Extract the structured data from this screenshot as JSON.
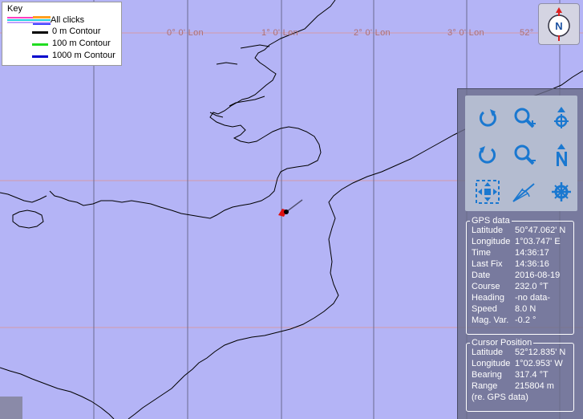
{
  "map": {
    "longitude_labels": [
      "0° 0' Lon",
      "1° 0' Lon",
      "2° 0' Lon",
      "3° 0' Lon",
      "52°"
    ]
  },
  "key": {
    "title": "Key",
    "clicks_label": "All clicks",
    "items": [
      {
        "label": "0 m Contour",
        "color": "#000000"
      },
      {
        "label": "100 m Contour",
        "color": "#22dd22"
      },
      {
        "label": "1000 m Contour",
        "color": "#0000cc"
      }
    ]
  },
  "compass": {
    "letter": "N"
  },
  "gps": {
    "title": "GPS data",
    "rows": [
      {
        "key": "Latitude",
        "value": "50°47.062' N"
      },
      {
        "key": "Longitude",
        "value": " 1°03.747' E"
      },
      {
        "key": "Time",
        "value": "14:36:17"
      },
      {
        "key": "Last Fix",
        "value": "14:36:16"
      },
      {
        "key": "Date",
        "value": "2016-08-19"
      },
      {
        "key": "Course",
        "value": "232.0 °T"
      },
      {
        "key": "Heading",
        "value": "-no data-"
      },
      {
        "key": "Speed",
        "value": "8.0 N"
      },
      {
        "key": "Mag. Var.",
        "value": "-0.2 °"
      }
    ]
  },
  "cursor": {
    "title": "Cursor Position",
    "rows": [
      {
        "key": "Latitude",
        "value": "52°12.835' N"
      },
      {
        "key": "Longitude",
        "value": "1°02.953' W"
      },
      {
        "key": "Bearing",
        "value": "317.4 °T"
      },
      {
        "key": "Range",
        "value": "215804 m"
      }
    ],
    "note": "(re. GPS data)"
  },
  "colors": {
    "sea": "#b4b4f6",
    "grid": "#d49aa8",
    "meridian": "#6a6a90",
    "coast": "#000000",
    "icon": "#1a78d0",
    "vessel": "#dd1111"
  }
}
